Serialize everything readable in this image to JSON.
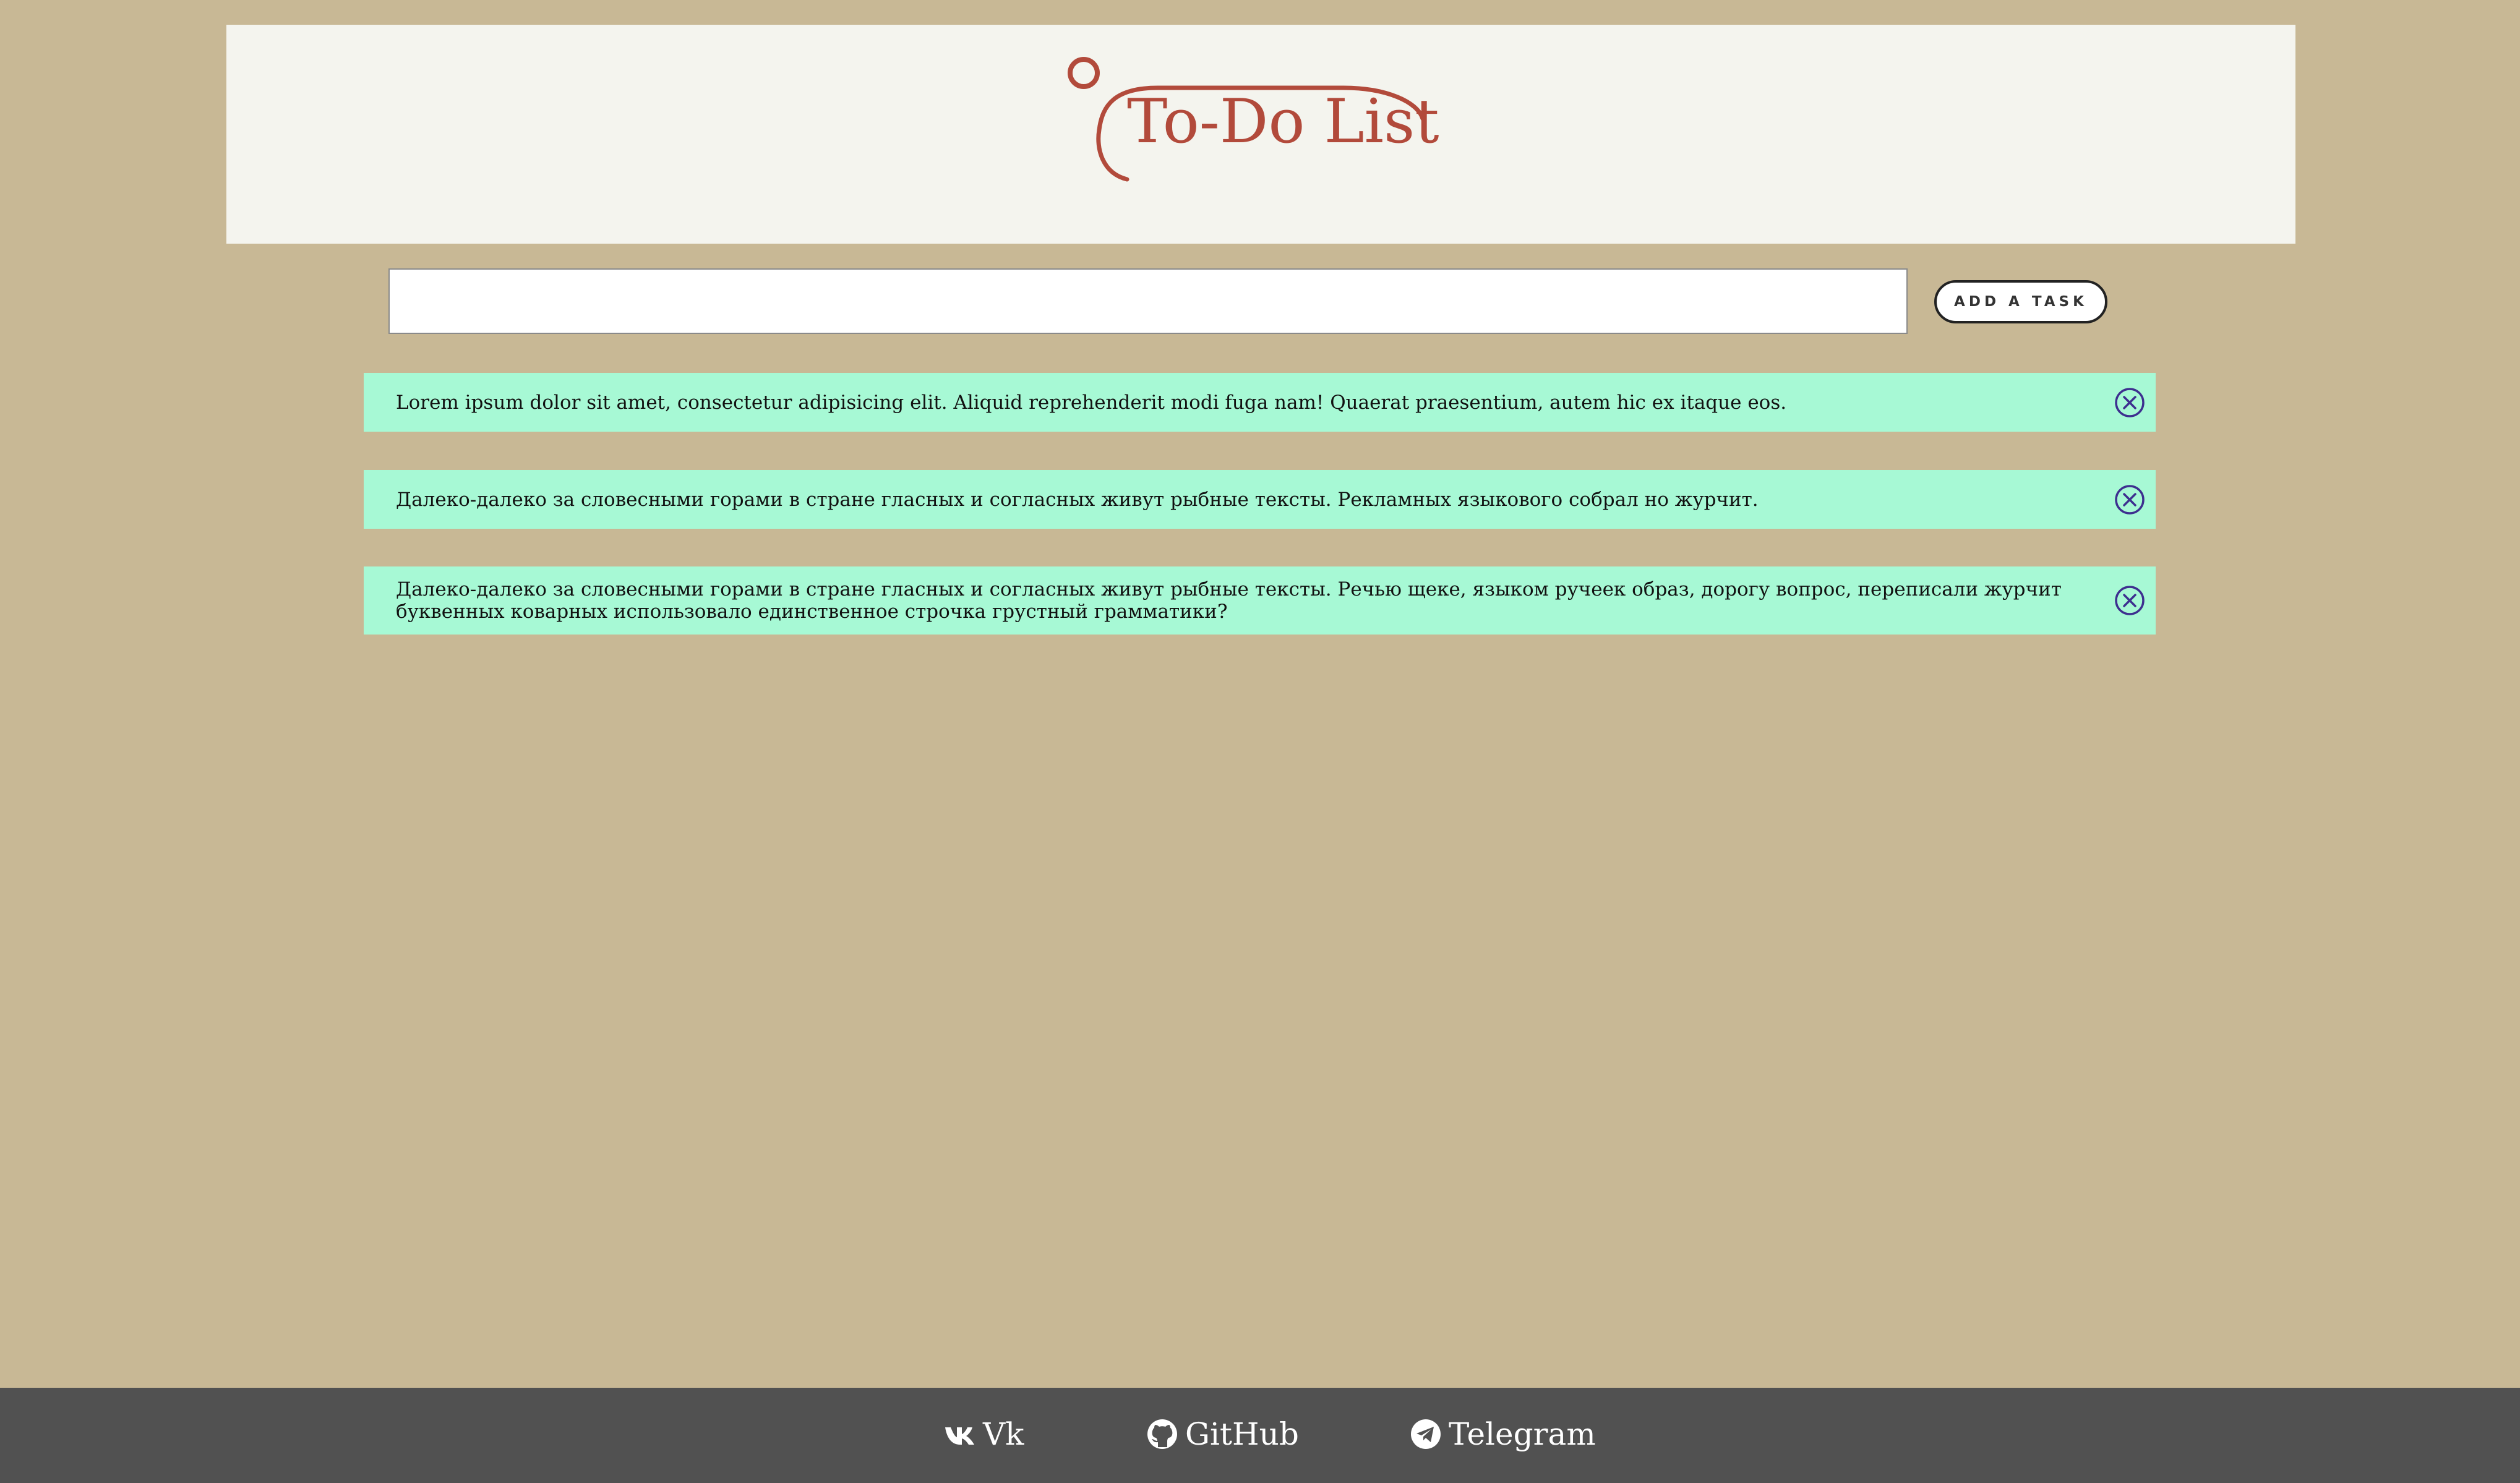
{
  "header": {
    "title": "To-Do List"
  },
  "form": {
    "input_value": "",
    "input_placeholder": "",
    "add_button_label": "ADD A TASK"
  },
  "tasks": [
    {
      "text": "Lorem ipsum dolor sit amet, consectetur adipisicing elit. Aliquid reprehenderit modi fuga nam! Quaerat praesentium, autem hic ex itaque eos."
    },
    {
      "text": "Далеко-далеко за словесными горами в стране гласных и согласных живут рыбные тексты. Рекламных языкового собрал но журчит."
    },
    {
      "text": "Далеко-далеко за словесными горами в стране гласных и согласных живут рыбные тексты. Речью щеке, языком ручеек образ, дорогу вопрос, переписали журчит буквенных коварных использовало единственное строчка грустный грамматики?"
    }
  ],
  "footer": {
    "links": [
      {
        "label": "Vk",
        "icon": "vk-icon"
      },
      {
        "label": "GitHub",
        "icon": "github-icon"
      },
      {
        "label": "Telegram",
        "icon": "telegram-icon"
      }
    ]
  },
  "colors": {
    "background": "#c8b895",
    "header_background": "#f4f4ee",
    "accent": "#b24a3b",
    "task_background": "#a7f9d5",
    "delete_icon": "#3d2f8f",
    "footer_background": "#515151"
  }
}
